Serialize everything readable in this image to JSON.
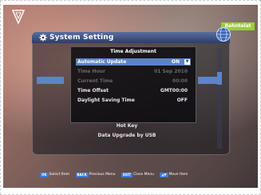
{
  "badge": {
    "channel": "Bahntelat"
  },
  "panel": {
    "title": "System Setting",
    "menu_items": [
      "Hot Key",
      "Data Upgrade by USB"
    ]
  },
  "dialog": {
    "title": "Time Adjustment",
    "rows": [
      {
        "label": "Automatic Update",
        "value": "ON",
        "state": "selected"
      },
      {
        "label": "Time Hour",
        "value": "01 Sep 2010",
        "state": "disabled"
      },
      {
        "label": "Current Time",
        "value": "00:00",
        "state": "disabled"
      },
      {
        "label": "Time Offset",
        "value": "GMT00:00",
        "state": "enabled"
      },
      {
        "label": "Daylight Saving Time",
        "value": "OFF",
        "state": "enabled"
      }
    ]
  },
  "footer": {
    "hints": [
      {
        "key": "OK",
        "label": "Select Item"
      },
      {
        "key": "BACK",
        "label": "Previous Menu"
      },
      {
        "key": "EXIT",
        "label": "Close Menu"
      },
      {
        "key": "▲▼",
        "label": "Move Item"
      }
    ]
  },
  "colors": {
    "highlight": "#5d84c6",
    "title_bar": "#2d3c6c",
    "badge": "#9ccc3a"
  },
  "icons": [
    "brand-logo-icon",
    "gear-icon",
    "globe-icon",
    "dropdown-arrow-icon"
  ]
}
